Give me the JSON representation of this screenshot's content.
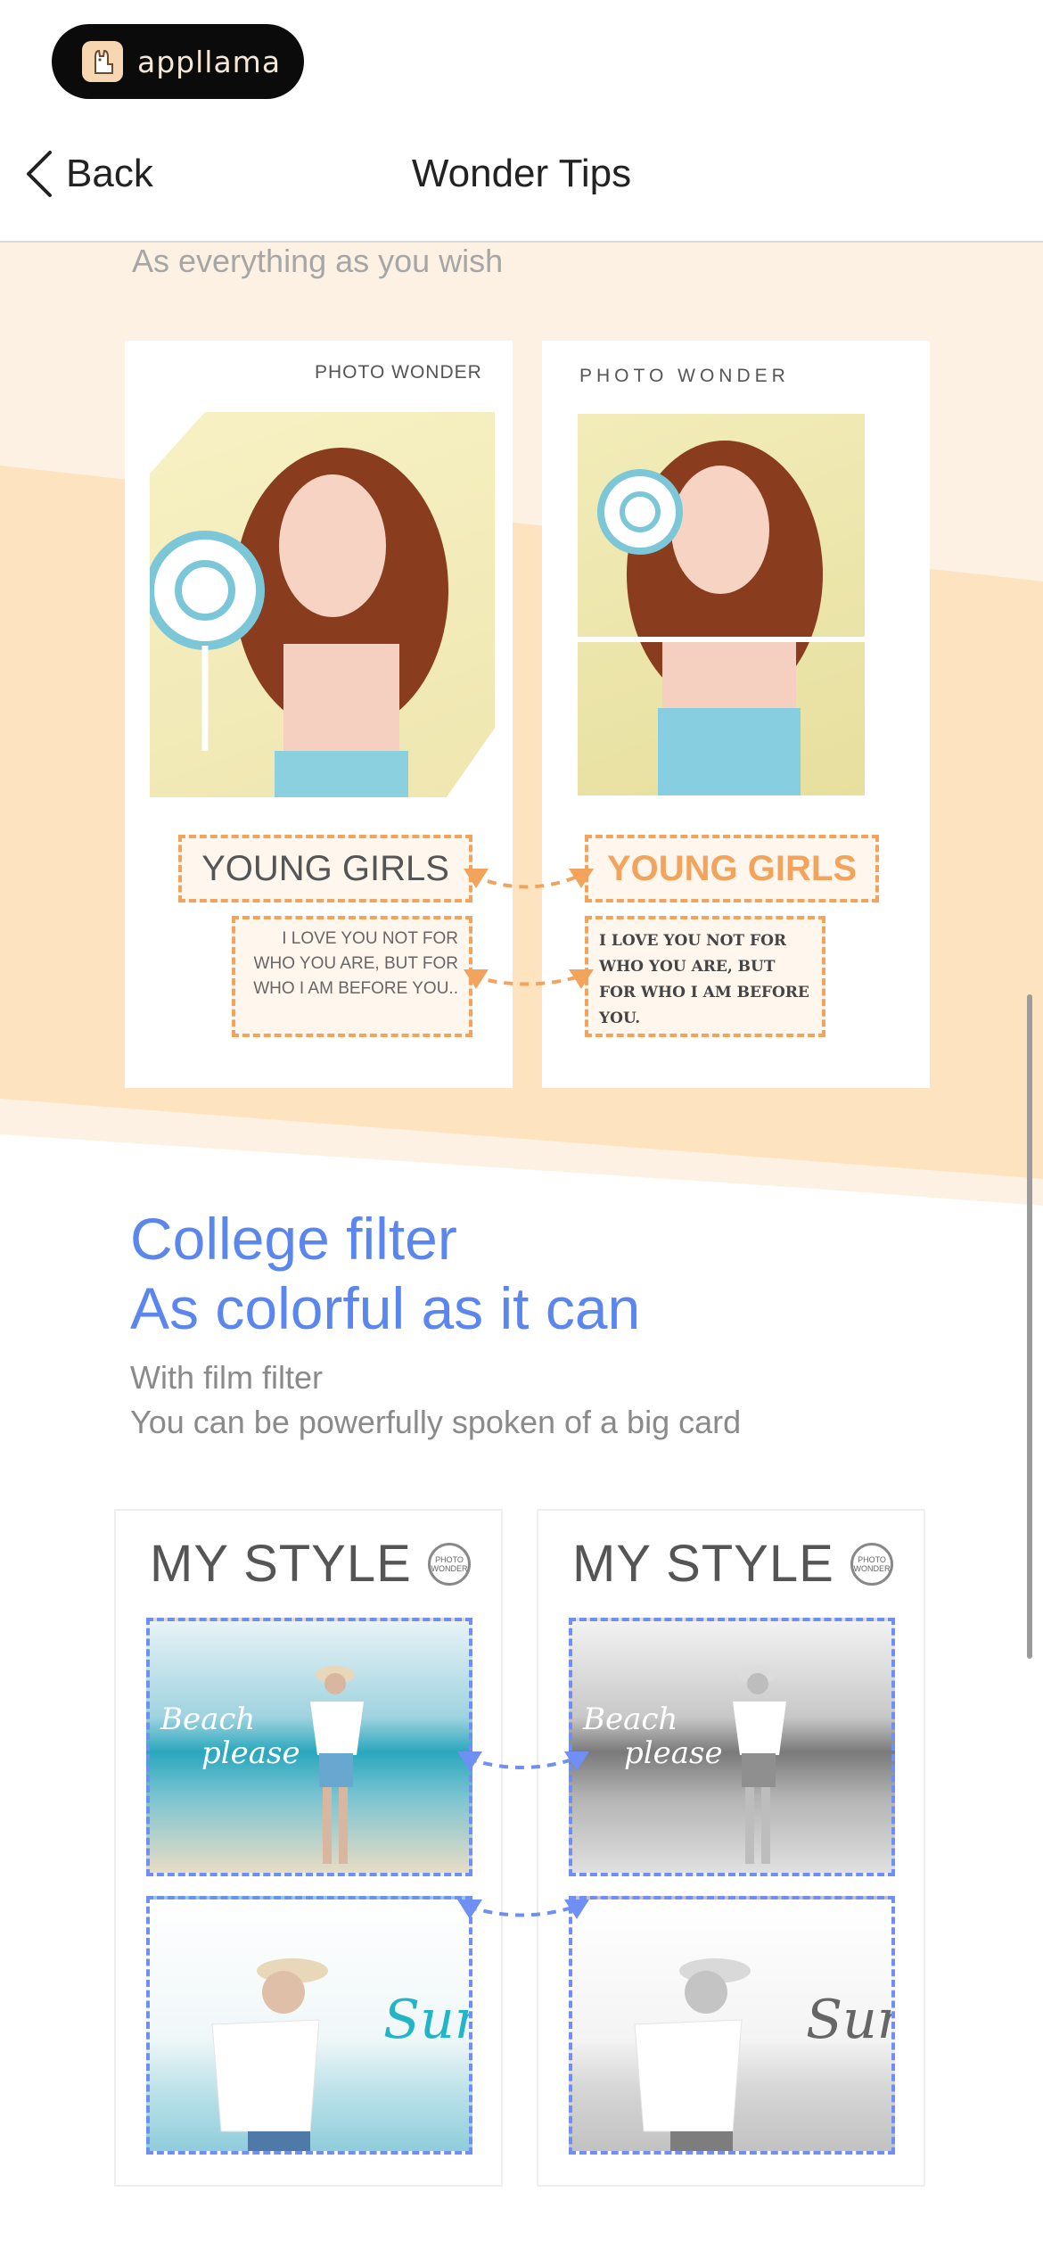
{
  "brand": {
    "name": "appllama",
    "logo_icon": "llama-icon"
  },
  "nav": {
    "back_label": "Back",
    "title": "Wonder Tips"
  },
  "section1": {
    "caption": "As everything as you wish",
    "left_card": {
      "header": "PHOTO WONDER",
      "title": "YOUNG GIRLS",
      "body": "I LOVE YOU NOT FOR WHO YOU ARE, BUT FOR WHO I AM BEFORE YOU.."
    },
    "right_card": {
      "header": "PHOTO WONDER",
      "title": "YOUNG GIRLS",
      "body": "I LOVE YOU NOT FOR WHO YOU ARE, BUT FOR WHO I AM BEFORE YOU."
    }
  },
  "section2": {
    "heading_line1": "College filter",
    "heading_line2": "As colorful as it can",
    "sub_line1": "With film filter",
    "sub_line2": "You can be powerfully spoken of a big card",
    "left_card": {
      "title": "MY STYLE",
      "badge": "PHOTO WONDER",
      "photo1_text_a": "Beach",
      "photo1_text_b": "please",
      "photo2_text": "Sum"
    },
    "right_card": {
      "title": "MY STYLE",
      "badge": "PHOTO WONDER",
      "photo1_text_a": "Beach",
      "photo1_text_b": "please",
      "photo2_text": "Sum"
    }
  },
  "colors": {
    "accent_blue": "#5b86ee",
    "accent_orange": "#f2a35c",
    "cream": "#fdebd3"
  }
}
